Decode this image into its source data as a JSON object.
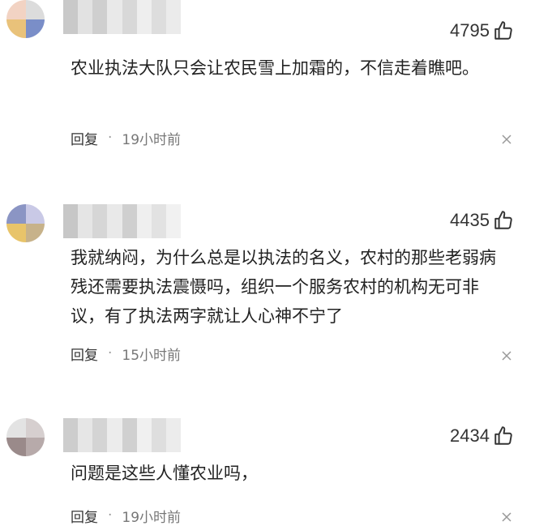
{
  "comments": [
    {
      "avatar_colors": [
        "#f2d3c3",
        "#dcdcdc",
        "#e9c27a",
        "#7a8ec8"
      ],
      "username_colors": [
        "#c9c9c9",
        "#e2e2e2",
        "#cfcfcf",
        "#e9e9e9",
        "#d8d8d8",
        "#eeeeee",
        "#dddddd",
        "#ebebeb"
      ],
      "likes": "4795",
      "text": "农业执法大队只会让农民雪上加霜的，不信走着瞧吧。",
      "reply_label": "回复",
      "separator": "·",
      "time": "19小时前"
    },
    {
      "avatar_colors": [
        "#8b95c4",
        "#c9c9e6",
        "#e8c46a",
        "#c7b28a"
      ],
      "username_colors": [
        "#c7c7c7",
        "#e5e5e5",
        "#d6d6d6",
        "#e9e9e9",
        "#cfcfcf",
        "#efefef",
        "#e2e2e2",
        "#f1f1f1"
      ],
      "likes": "4435",
      "text": "我就纳闷，为什么总是以执法的名义，农村的那些老弱病残还需要执法震慑吗，组织一个服务农村的机构无可非议，有了执法两字就让人心神不宁了",
      "reply_label": "回复",
      "separator": "·",
      "time": "15小时前"
    },
    {
      "avatar_colors": [
        "#e3e3e3",
        "#d6cfcf",
        "#9a8a8a",
        "#b7aaaa"
      ],
      "username_colors": [
        "#cdcdcd",
        "#e6e6e6",
        "#d4d4d4",
        "#ececec",
        "#d0d0d0",
        "#f0f0f0",
        "#dedede",
        "#ececec"
      ],
      "likes": "2434",
      "text": "问题是这些人懂农业吗，",
      "reply_label": "回复",
      "separator": "·",
      "time": "19小时前"
    }
  ],
  "icons": {
    "like": "thumbs-up-icon",
    "close": "close-icon"
  }
}
